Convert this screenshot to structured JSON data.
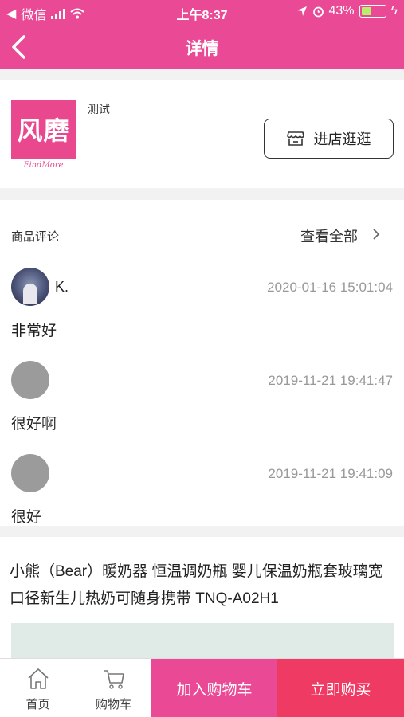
{
  "status_bar": {
    "carrier": "微信",
    "time": "上午8:37",
    "battery": "43%",
    "battery_level": 0.43
  },
  "nav": {
    "title": "详情"
  },
  "shop": {
    "logo_text": "风磨",
    "logo_subtext": "FindMore",
    "name": "测试",
    "visit_button": "进店逛逛"
  },
  "reviews": {
    "header": "商品评论",
    "view_all": "查看全部",
    "items": [
      {
        "user": "K.",
        "time": "2020-01-16 15:01:04",
        "content": "非常好"
      },
      {
        "user": "",
        "time": "2019-11-21 19:41:47",
        "content": "很好啊"
      },
      {
        "user": "",
        "time": "2019-11-21 19:41:09",
        "content": "很好"
      }
    ]
  },
  "product": {
    "title": "小熊（Bear）暖奶器 恒温调奶瓶 婴儿保温奶瓶套玻璃宽口径新生儿热奶可随身携带 TNQ-A02H1"
  },
  "tabbar": {
    "home": "首页",
    "cart": "购物车",
    "add_to_cart": "加入购物车",
    "buy_now": "立即购买"
  },
  "colors": {
    "brand_pink": "#ea4a95",
    "buy_red": "#ef3a63"
  }
}
